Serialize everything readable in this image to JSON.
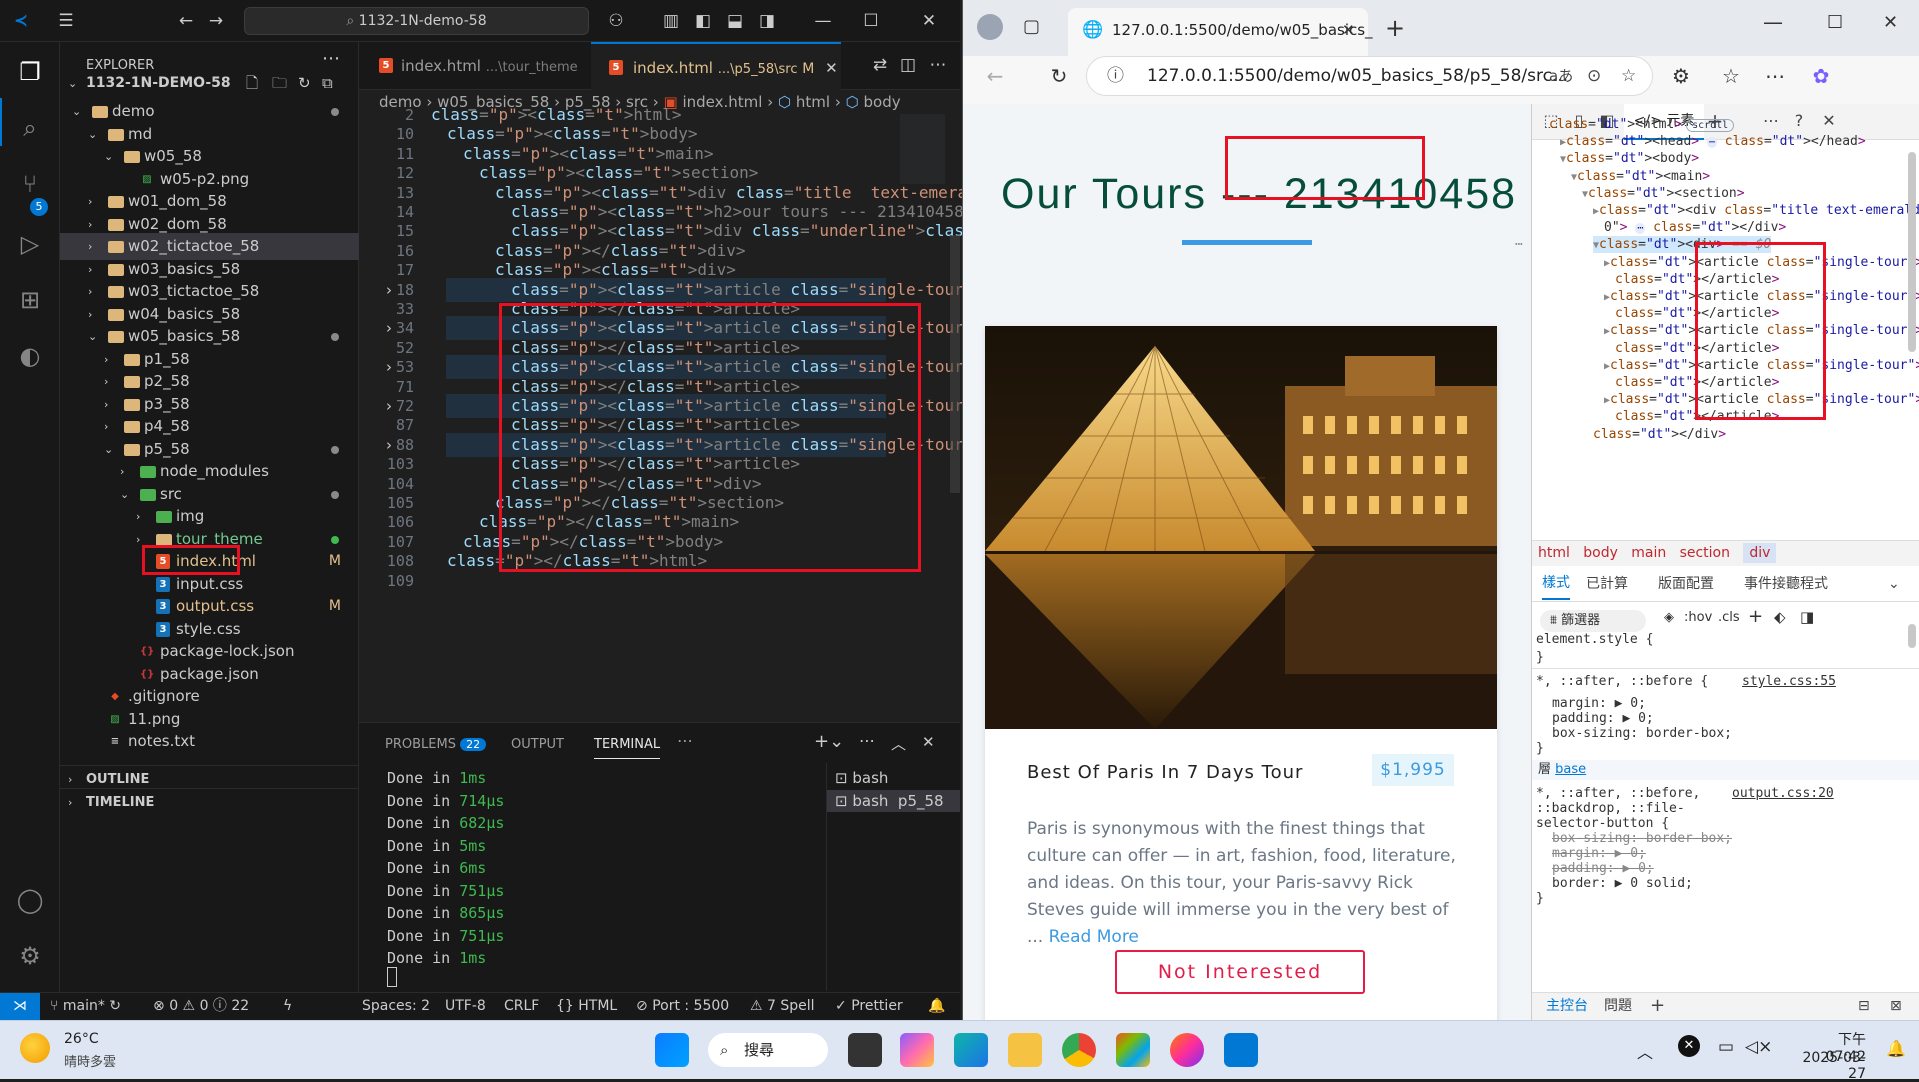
{
  "vscode": {
    "command_center": "1132-1N-demo-58",
    "explorer_title": "EXPLORER",
    "workspace": "1132-1N-DEMO-58",
    "tree": [
      {
        "label": "demo",
        "type": "folder",
        "depth": 1,
        "open": true,
        "dot": "#8a8a8a"
      },
      {
        "label": "md",
        "type": "folder",
        "depth": 2,
        "open": true
      },
      {
        "label": "w05_58",
        "type": "folder",
        "depth": 3,
        "open": true
      },
      {
        "label": "w05-p2.png",
        "type": "image",
        "depth": 4
      },
      {
        "label": "w01_dom_58",
        "type": "folder",
        "depth": 2,
        "open": false
      },
      {
        "label": "w02_dom_58",
        "type": "folder",
        "depth": 2,
        "open": false
      },
      {
        "label": "w02_tictactoe_58",
        "type": "folder",
        "depth": 2,
        "open": false,
        "selected": true
      },
      {
        "label": "w03_basics_58",
        "type": "folder",
        "depth": 2,
        "open": false
      },
      {
        "label": "w03_tictactoe_58",
        "type": "folder",
        "depth": 2,
        "open": false
      },
      {
        "label": "w04_basics_58",
        "type": "folder",
        "depth": 2,
        "open": false
      },
      {
        "label": "w05_basics_58",
        "type": "folder",
        "depth": 2,
        "open": true,
        "dot": "#8a8a8a"
      },
      {
        "label": "p1_58",
        "type": "folder",
        "depth": 3,
        "open": false
      },
      {
        "label": "p2_58",
        "type": "folder",
        "depth": 3,
        "open": false
      },
      {
        "label": "p3_58",
        "type": "folder",
        "depth": 3,
        "open": false
      },
      {
        "label": "p4_58",
        "type": "folder",
        "depth": 3,
        "open": false
      },
      {
        "label": "p5_58",
        "type": "folder",
        "depth": 3,
        "open": true,
        "dot": "#8a8a8a"
      },
      {
        "label": "node_modules",
        "type": "folder-green",
        "depth": 4,
        "open": false
      },
      {
        "label": "src",
        "type": "folder-green",
        "depth": 4,
        "open": true,
        "dot": "#8a8a8a"
      },
      {
        "label": "img",
        "type": "folder-green",
        "depth": 5,
        "open": false
      },
      {
        "label": "tour_theme",
        "type": "folder",
        "depth": 5,
        "open": false,
        "dot": "#3fb950",
        "color": "#73c991"
      },
      {
        "label": "index.html",
        "type": "html",
        "depth": 5,
        "mark": "M",
        "active": true,
        "color": "#e2c08d"
      },
      {
        "label": "input.css",
        "type": "css",
        "depth": 5
      },
      {
        "label": "output.css",
        "type": "css",
        "depth": 5,
        "mark": "M",
        "color": "#e2c08d"
      },
      {
        "label": "style.css",
        "type": "css",
        "depth": 5
      },
      {
        "label": "package-lock.json",
        "type": "json",
        "depth": 4
      },
      {
        "label": "package.json",
        "type": "json",
        "depth": 4
      },
      {
        "label": ".gitignore",
        "type": "git",
        "depth": 2
      },
      {
        "label": "11.png",
        "type": "image",
        "depth": 2
      },
      {
        "label": "notes.txt",
        "type": "txt",
        "depth": 2
      }
    ],
    "outline": "OUTLINE",
    "timeline": "TIMELINE",
    "tabs": [
      {
        "label": "index.html",
        "desc": "...\\tour_theme",
        "active": false
      },
      {
        "label": "index.html",
        "desc": "...\\p5_58\\src",
        "mark": "M",
        "active": true
      }
    ],
    "breadcrumb": [
      "demo",
      "w05_basics_58",
      "p5_58",
      "src",
      "index.html",
      "html",
      "body"
    ],
    "code_lines": [
      {
        "n": "2",
        "text": "<html>"
      },
      {
        "n": "10",
        "text": "<body>"
      },
      {
        "n": "11",
        "text": "<main>"
      },
      {
        "n": "12",
        "text": "<section>"
      },
      {
        "n": "13",
        "text": "<div class=\"title  text-emerald-700\">"
      },
      {
        "n": "14",
        "text": "<h2>our tours --- 213410458</h2>"
      },
      {
        "n": "15",
        "text": "<div class=\"underline\"></div>"
      },
      {
        "n": "16",
        "text": "</div>"
      },
      {
        "n": "17",
        "text": "<div>"
      },
      {
        "n": "18",
        "text": "<article class=\"single-tour\">…"
      },
      {
        "n": "33",
        "text": "</article>"
      },
      {
        "n": "34",
        "text": "<article class=\"single-tour\">…"
      },
      {
        "n": "52",
        "text": "</article>"
      },
      {
        "n": "53",
        "text": "<article class=\"single-tour\">…"
      },
      {
        "n": "71",
        "text": "</article>"
      },
      {
        "n": "72",
        "text": "<article class=\"single-tour\">…"
      },
      {
        "n": "87",
        "text": "</article>"
      },
      {
        "n": "88",
        "text": "<article class=\"single-tour\">…"
      },
      {
        "n": "103",
        "text": "</article>"
      },
      {
        "n": "104",
        "text": "</div>"
      },
      {
        "n": "105",
        "text": "</section>"
      },
      {
        "n": "106",
        "text": "</main>"
      },
      {
        "n": "107",
        "text": "</body>"
      },
      {
        "n": "108",
        "text": "</html>"
      },
      {
        "n": "109",
        "text": ""
      }
    ],
    "panel_tabs": {
      "problems": "PROBLEMS",
      "problems_count": "22",
      "output": "OUTPUT",
      "terminal": "TERMINAL"
    },
    "terminal_lines": [
      {
        "text": "Done in ",
        "time": "1ms"
      },
      {
        "text": "Done in ",
        "time": "714µs"
      },
      {
        "text": "Done in ",
        "time": "682µs"
      },
      {
        "text": "Done in ",
        "time": "5ms"
      },
      {
        "text": "Done in ",
        "time": "6ms"
      },
      {
        "text": "Done in ",
        "time": "751µs"
      },
      {
        "text": "Done in ",
        "time": "865µs"
      },
      {
        "text": "Done in ",
        "time": "751µs"
      },
      {
        "text": "Done in ",
        "time": "1ms"
      }
    ],
    "terminals": [
      "bash",
      "bash  p5_58"
    ],
    "status": {
      "branch": "main*",
      "errors": "0",
      "warnings": "0",
      "infos": "22",
      "spaces": "Spaces: 2",
      "encoding": "UTF-8",
      "eol": "CRLF",
      "lang": "HTML",
      "port": "Port : 5500",
      "spell": "7 Spell",
      "prettier": "Prettier"
    }
  },
  "browser": {
    "tab_title": "127.0.0.1:5500/demo/w05_basics_",
    "url": "127.0.0.1:5500/demo/w05_basics_58/p5_58/src...",
    "page": {
      "title_prefix": "Our Tours ---",
      "title_id": "213410458",
      "tour_name": "Best Of Paris In 7 Days Tour",
      "price": "$1,995",
      "description": "Paris is synonymous with the finest things that culture can offer — in art, fashion, food, literature, and ideas. On this tour, your Paris-savvy Rick Steves guide will immerse you in the very best of ...",
      "read_more": "Read More",
      "button": "Not Interested"
    },
    "devtools": {
      "elements_tab": "元素",
      "dom": [
        {
          "t": "<html>",
          "badge": "scroll"
        },
        {
          "t": "<head>",
          "tail": "</head>"
        },
        {
          "t": "<body>"
        },
        {
          "t": "<main>"
        },
        {
          "t": "<section>"
        },
        {
          "t": "<div class=\"title text-emerald-70"
        },
        {
          "t": "0\">",
          "tail": "</div>"
        },
        {
          "t": "<div>",
          "suffix": "== $0"
        },
        {
          "t": "<article class=\"single-tour\">"
        },
        {
          "t": "</article>"
        },
        {
          "t": "<article class=\"single-tour\">"
        },
        {
          "t": "</article>"
        },
        {
          "t": "<article class=\"single-tour\">"
        },
        {
          "t": "</article>"
        },
        {
          "t": "<article class=\"single-tour\">"
        },
        {
          "t": "</article>"
        },
        {
          "t": "<article class=\"single-tour\">"
        },
        {
          "t": "</article>"
        },
        {
          "t": "</div>"
        }
      ],
      "crumbs": [
        "html",
        "body",
        "main",
        "section",
        "div"
      ],
      "style_tabs": [
        "樣式",
        "已計算",
        "版面配置",
        "事件接聽程式"
      ],
      "filter": "篩選器",
      "hov": ":hov",
      "cls": ".cls",
      "rule1_sel": "element.style {",
      "rule2_sel": "*, ::after, ::before {",
      "rule2_src": "style.css:55",
      "rule2_props": [
        "margin: ▶ 0;",
        "padding: ▶ 0;",
        "box-sizing: border-box;"
      ],
      "layer": "base",
      "layer_prefix": "層",
      "rule3_sel1": "*, ::after, ::before,",
      "rule3_sel2": "::backdrop, ::file-",
      "rule3_sel3": "selector-button {",
      "rule3_src": "output.css:20",
      "rule3_props": [
        "box-sizing: border-box;",
        "margin: ▶ 0;",
        "padding: ▶ 0;",
        "border: ▶ 0 solid;"
      ],
      "console": "主控台",
      "issues": "問題"
    }
  },
  "taskbar": {
    "temp": "26°C",
    "weather": "晴時多雲",
    "search": "搜尋",
    "time": "下午 07:42",
    "date": "2025-03-27"
  }
}
